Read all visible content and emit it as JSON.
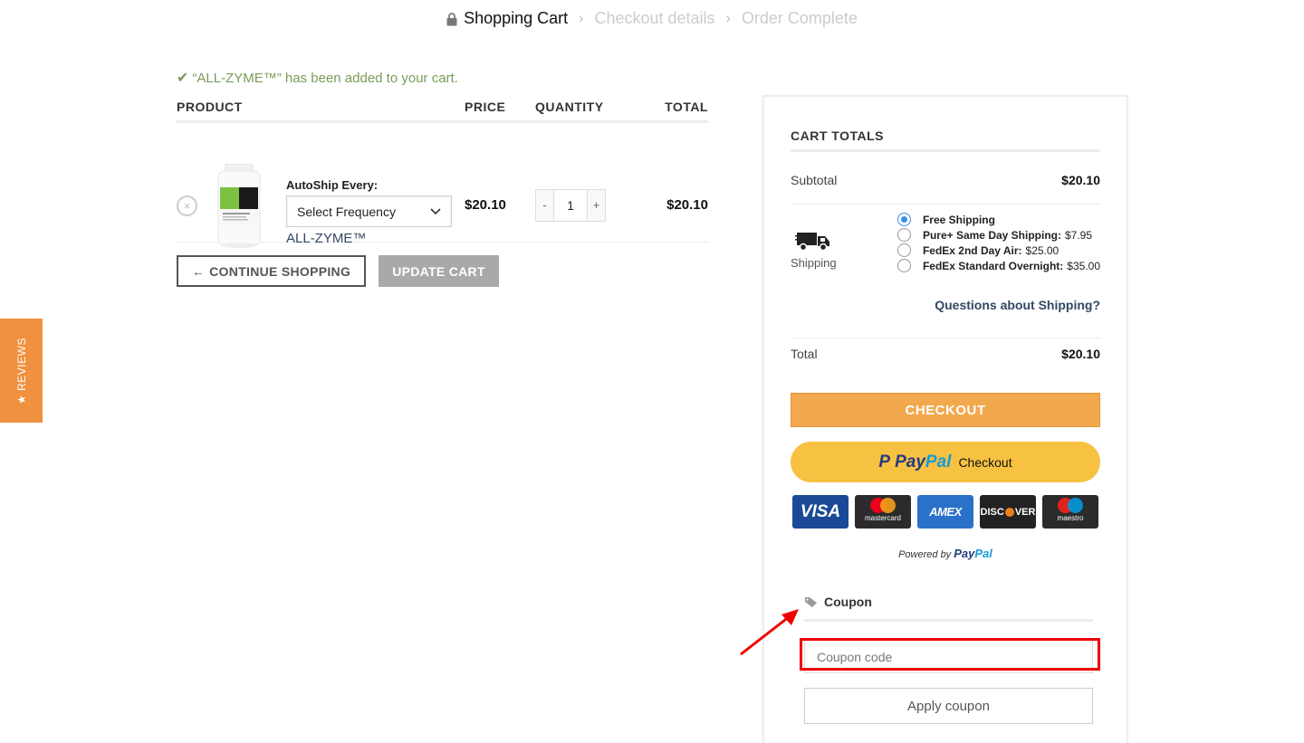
{
  "breadcrumb": {
    "step1": "Shopping Cart",
    "step2": "Checkout details",
    "step3": "Order Complete"
  },
  "notice": "“ALL-ZYME™” has been added to your cart.",
  "cart": {
    "headers": {
      "product": "PRODUCT",
      "price": "PRICE",
      "quantity": "QUANTITY",
      "total": "TOTAL"
    },
    "items": [
      {
        "autoship_label": "AutoShip Every:",
        "frequency": "Select Frequency",
        "name": "ALL-ZYME™",
        "price": "$20.10",
        "quantity": "1",
        "qty_minus": "-",
        "qty_plus": "+",
        "total": "$20.10"
      }
    ],
    "continue_label": "CONTINUE SHOPPING",
    "update_label": "UPDATE CART"
  },
  "reviews_tab": "★ REVIEWS",
  "totals": {
    "title": "CART TOTALS",
    "subtotal_label": "Subtotal",
    "subtotal": "$20.10",
    "shipping_label": "Shipping",
    "shipping_options": [
      {
        "label": "Free Shipping",
        "selected": true
      },
      {
        "label": "Pure+ Same Day Shipping: ",
        "price": "$7.95",
        "selected": false
      },
      {
        "label": "FedEx 2nd Day Air: ",
        "price": "$25.00",
        "selected": false
      },
      {
        "label": "FedEx Standard Overnight: ",
        "price": "$35.00",
        "selected": false
      }
    ],
    "shipping_question": "Questions about Shipping?",
    "total_label": "Total",
    "total": "$20.10",
    "checkout_label": "CHECKOUT",
    "paypal": {
      "mark": "P",
      "brand_a": "Pay",
      "brand_b": "Pal",
      "checkout": "Checkout"
    },
    "cards": {
      "visa": "VISA",
      "mastercard": "mastercard",
      "amex": "AMEX",
      "discover_a": "DISC",
      "discover_b": "VER",
      "maestro": "maestro"
    },
    "powered_by": "Powered by ",
    "coupon_title": "Coupon",
    "coupon_placeholder": "Coupon code",
    "apply_label": "Apply coupon"
  },
  "colors": {
    "accent_orange": "#f2a94d",
    "paypal_yellow": "#f7c141",
    "success_green": "#7a9c59",
    "link_blue": "#334862",
    "highlight_red": "#e00000"
  }
}
